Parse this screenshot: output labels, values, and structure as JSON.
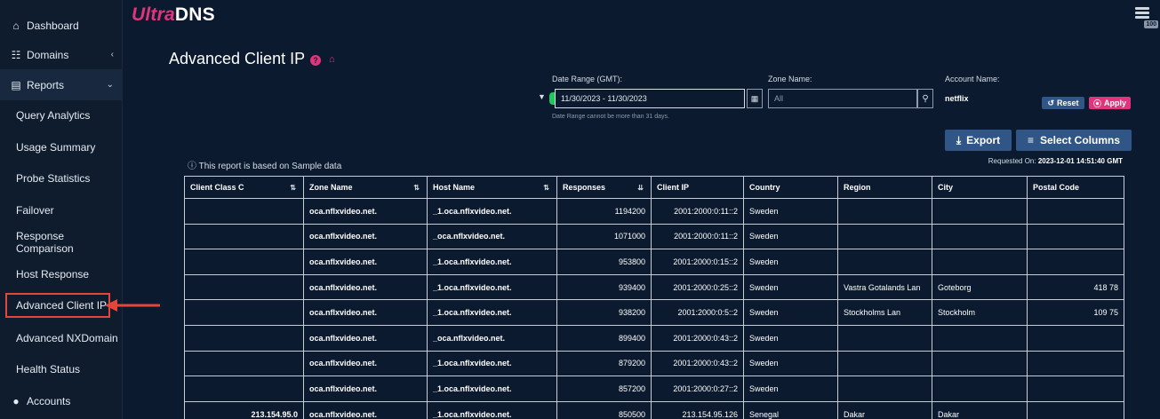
{
  "brand": {
    "ultra": "Ultra",
    "dns": "DNS"
  },
  "top_badge": "100",
  "sidebar": {
    "items": [
      {
        "label": "Dashboard",
        "icon": "home-icon"
      },
      {
        "label": "Domains",
        "icon": "sitemap-icon"
      },
      {
        "label": "Reports",
        "icon": "bar-chart-icon"
      },
      {
        "label": "Query Analytics"
      },
      {
        "label": "Usage Summary"
      },
      {
        "label": "Probe Statistics"
      },
      {
        "label": "Failover"
      },
      {
        "label": "Response Comparison"
      },
      {
        "label": "Host Response"
      },
      {
        "label": "Advanced Client IP"
      },
      {
        "label": "Advanced NXDomain"
      },
      {
        "label": "Health Status"
      },
      {
        "label": "Accounts",
        "icon": "user-icon"
      }
    ]
  },
  "page": {
    "title": "Advanced Client IP"
  },
  "filters": {
    "date_range_label": "Date Range (GMT):",
    "date_range_value": "11/30/2023 - 11/30/2023",
    "date_hint": "Date Range cannot be more than 31 days.",
    "zone_label": "Zone Name:",
    "zone_value": "All",
    "account_label": "Account Name:",
    "account_value": "netflix",
    "reset_label": "Reset",
    "apply_label": "Apply"
  },
  "actions": {
    "export_label": "Export",
    "select_columns_label": "Select Columns"
  },
  "requested": {
    "label": "Requested On:",
    "value": "2023-12-01 14:51:40 GMT"
  },
  "sample_note": "This report is based on Sample data",
  "table": {
    "columns": [
      "Client Class C",
      "Zone Name",
      "Host Name",
      "Responses",
      "Client IP",
      "Country",
      "Region",
      "City",
      "Postal Code"
    ],
    "rows": [
      [
        "",
        "oca.nflxvideo.net.",
        "_1.oca.nflxvideo.net.",
        "1194200",
        "2001:2000:0:11::2",
        "Sweden",
        "",
        "",
        ""
      ],
      [
        "",
        "oca.nflxvideo.net.",
        "_oca.nflxvideo.net.",
        "1071000",
        "2001:2000:0:11::2",
        "Sweden",
        "",
        "",
        ""
      ],
      [
        "",
        "oca.nflxvideo.net.",
        "_1.oca.nflxvideo.net.",
        "953800",
        "2001:2000:0:15::2",
        "Sweden",
        "",
        "",
        ""
      ],
      [
        "",
        "oca.nflxvideo.net.",
        "_1.oca.nflxvideo.net.",
        "939400",
        "2001:2000:0:25::2",
        "Sweden",
        "Vastra Gotalands Lan",
        "Goteborg",
        "418 78"
      ],
      [
        "",
        "oca.nflxvideo.net.",
        "_1.oca.nflxvideo.net.",
        "938200",
        "2001:2000:0:5::2",
        "Sweden",
        "Stockholms Lan",
        "Stockholm",
        "109 75"
      ],
      [
        "",
        "oca.nflxvideo.net.",
        "_oca.nflxvideo.net.",
        "899400",
        "2001:2000:0:43::2",
        "Sweden",
        "",
        "",
        ""
      ],
      [
        "",
        "oca.nflxvideo.net.",
        "_1.oca.nflxvideo.net.",
        "879200",
        "2001:2000:0:43::2",
        "Sweden",
        "",
        "",
        ""
      ],
      [
        "",
        "oca.nflxvideo.net.",
        "_1.oca.nflxvideo.net.",
        "857200",
        "2001:2000:0:27::2",
        "Sweden",
        "",
        "",
        ""
      ],
      [
        "213.154.95.0",
        "oca.nflxvideo.net.",
        "_1.oca.nflxvideo.net.",
        "850500",
        "213.154.95.126",
        "Senegal",
        "Dakar",
        "Dakar",
        ""
      ]
    ]
  },
  "colors": {
    "accent": "#e2347d",
    "primary_button": "#2f5686",
    "background": "#0b1a2e",
    "highlight": "#e4463a"
  }
}
